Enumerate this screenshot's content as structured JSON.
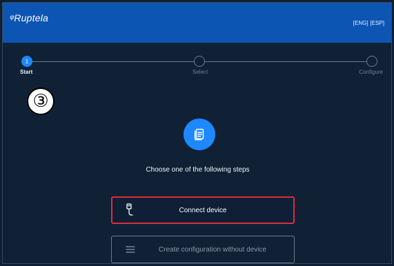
{
  "header": {
    "logo": "ᵠRuptela",
    "lang": [
      "[ENG]",
      "[ESP]"
    ]
  },
  "stepper": {
    "steps": [
      {
        "index": "1",
        "label": "Start"
      },
      {
        "label": "Select"
      },
      {
        "label": "Configure"
      }
    ]
  },
  "annotation": {
    "number": "③"
  },
  "content": {
    "prompt": "Choose one of the following steps",
    "connect_label": "Connect device",
    "create_label": "Create configuration without device"
  },
  "colors": {
    "header_bg": "#0d55b3",
    "page_bg": "#102136",
    "accent": "#1e88ff",
    "highlight": "#e02c3a"
  },
  "icons": {
    "doc": "document-stack-icon",
    "usb": "usb-cable-icon",
    "menu": "hamburger-lines-icon"
  }
}
